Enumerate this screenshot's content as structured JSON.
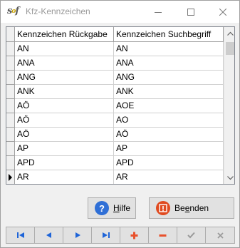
{
  "window": {
    "title": "Kfz-Kennzeichen",
    "icon": "app-logo-icon",
    "logo_text": "s",
    "logo_sup": "o",
    "logo_tail": "f"
  },
  "grid": {
    "columns": [
      "Kennzeichen Rückgabe",
      "Kennzeichen Suchbegriff"
    ],
    "rows": [
      [
        "AN",
        "AN"
      ],
      [
        "ANA",
        "ANA"
      ],
      [
        "ANG",
        "ANG"
      ],
      [
        "ANK",
        "ANK"
      ],
      [
        "AÖ",
        "AOE"
      ],
      [
        "AÖ",
        "AO"
      ],
      [
        "AÖ",
        "AÖ"
      ],
      [
        "AP",
        "AP"
      ],
      [
        "APD",
        "APD"
      ],
      [
        "AR",
        "AR"
      ]
    ],
    "current_row": 10
  },
  "buttons": {
    "help": {
      "label_pre": "",
      "label_accel": "H",
      "label_post": "ilfe",
      "icon": "help-icon"
    },
    "exit": {
      "label_pre": "Be",
      "label_accel": "e",
      "label_post": "nden",
      "icon": "exit-icon"
    }
  },
  "navigator": {
    "items": [
      "first",
      "prior",
      "next",
      "last",
      "insert",
      "delete",
      "post",
      "cancel"
    ]
  },
  "colors": {
    "nav_blue": "#1e64d8",
    "nav_red": "#e8512c",
    "nav_gray": "#9a9a9a",
    "help_blue": "#2f6fd6",
    "exit_red": "#e04a1f"
  }
}
